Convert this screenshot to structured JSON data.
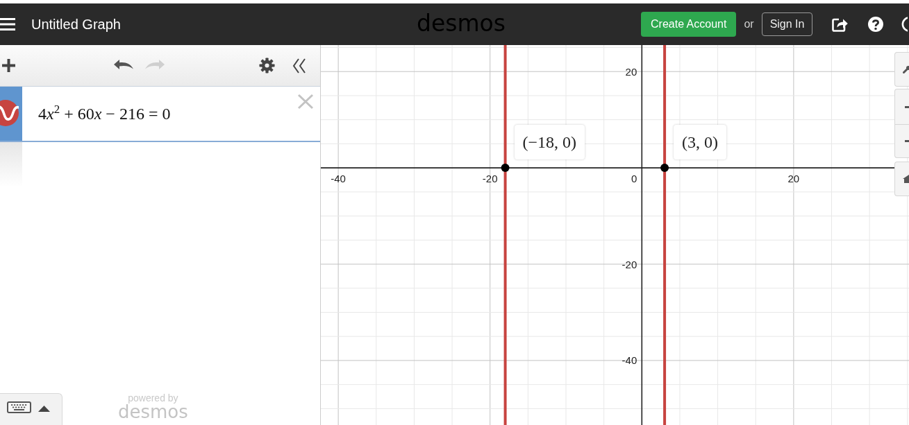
{
  "header": {
    "title": "Untitled Graph",
    "logo": "desmos",
    "create_account": "Create Account",
    "separator": "or",
    "sign_in": "Sign In"
  },
  "toolbar": {
    "undo": {
      "disabled": false
    },
    "redo": {
      "disabled": true
    }
  },
  "expressions": [
    {
      "text": "4x$^{2}$ + 60x − 216 = 0",
      "color": "#c74440",
      "selected": true
    }
  ],
  "footer": {
    "powered_by": "powered by",
    "brand": "desmos"
  },
  "graph": {
    "origin_label": "0",
    "chart_data": {
      "type": "scatter",
      "x": [
        -18,
        3
      ],
      "series": [
        {
          "color": "#000000",
          "values": [
            0,
            0
          ]
        }
      ],
      "xlim": [
        -42.3,
        35.2
      ],
      "ylim": [
        -53.4,
        25.5
      ],
      "xticks": [
        -40,
        -20,
        20
      ],
      "yticks": [
        -40,
        -20,
        20
      ],
      "grid": true,
      "ref_lines": [
        {
          "axis": "x",
          "value": -18,
          "color": "#c74440"
        },
        {
          "axis": "x",
          "value": 3,
          "color": "#c74440"
        }
      ],
      "annotations": [
        {
          "x": -18,
          "y": 0,
          "text": "(−18, 0)"
        },
        {
          "x": 3,
          "y": 0,
          "text": "(3, 0)"
        }
      ]
    }
  }
}
